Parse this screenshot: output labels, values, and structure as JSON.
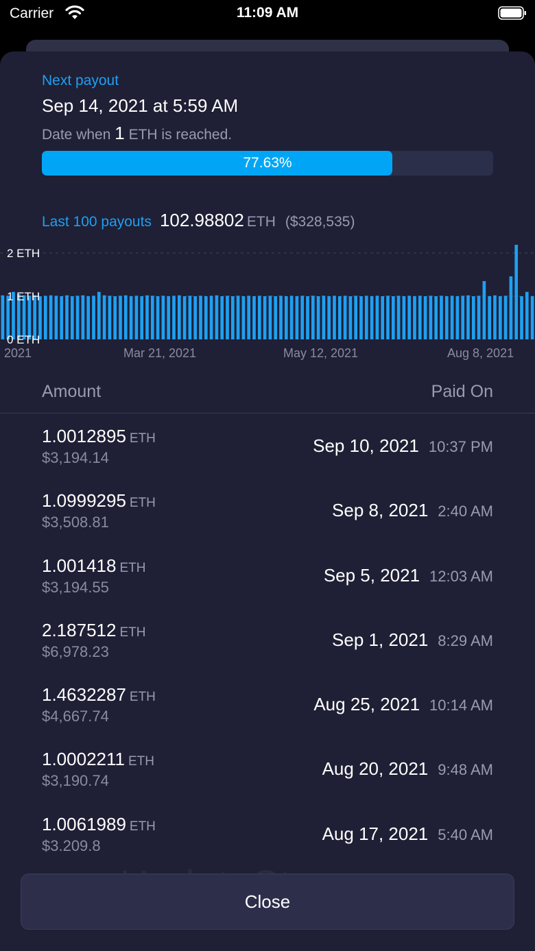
{
  "status_bar": {
    "carrier": "Carrier",
    "time": "11:09 AM"
  },
  "next_payout": {
    "label": "Next payout",
    "date": "Sep 14, 2021 at 5:59 AM",
    "hint_prefix": "Date when",
    "hint_amount": "1",
    "hint_suffix": "ETH is reached.",
    "progress_text": "77.63%",
    "progress_value": 0.7763
  },
  "summary": {
    "label": "Last 100 payouts",
    "total": "102.98802",
    "unit": "ETH",
    "usd": "($328,535)"
  },
  "chart_data": {
    "type": "bar",
    "y_ticks": [
      "2 ETH",
      "1 ETH",
      "0 ETH"
    ],
    "x_ticks": [
      ", 2021",
      "Mar 21, 2021",
      "May 12, 2021",
      "Aug 8, 2021"
    ],
    "ylim": [
      0,
      2
    ],
    "values": [
      1.02,
      1.01,
      1.1,
      1.05,
      1.02,
      1.01,
      1.02,
      1.0,
      1.01,
      1.02,
      1.01,
      1.0,
      1.02,
      1.0,
      1.01,
      1.02,
      1.0,
      1.01,
      1.1,
      1.02,
      1.01,
      1.0,
      1.01,
      1.02,
      1.0,
      1.01,
      1.0,
      1.02,
      1.01,
      1.0,
      1.01,
      1.0,
      1.01,
      1.02,
      1.0,
      1.01,
      1.0,
      1.01,
      1.0,
      1.01,
      1.02,
      1.0,
      1.01,
      1.0,
      1.01,
      1.0,
      1.01,
      1.0,
      1.01,
      1.0,
      1.01,
      1.0,
      1.01,
      1.0,
      1.01,
      1.0,
      1.01,
      1.0,
      1.01,
      1.0,
      1.01,
      1.0,
      1.01,
      1.0,
      1.01,
      1.0,
      1.01,
      1.0,
      1.01,
      1.0,
      1.01,
      1.0,
      1.01,
      1.0,
      1.01,
      1.0,
      1.01,
      1.0,
      1.01,
      1.0,
      1.01,
      1.0,
      1.01,
      1.0,
      1.01,
      1.0,
      1.01,
      1.02,
      1.0,
      1.01,
      1.35,
      1.0,
      1.02,
      1.0,
      1.01,
      1.46,
      2.19,
      1.0,
      1.1,
      1.0
    ],
    "bar_color": "#1ea0f2",
    "grid_color": "#3a3c55"
  },
  "table": {
    "col_amount": "Amount",
    "col_paid": "Paid On",
    "rows": [
      {
        "amount": "1.0012895",
        "unit": "ETH",
        "usd": "$3,194.14",
        "date": "Sep 10, 2021",
        "time": "10:37 PM"
      },
      {
        "amount": "1.0999295",
        "unit": "ETH",
        "usd": "$3,508.81",
        "date": "Sep 8, 2021",
        "time": "2:40 AM"
      },
      {
        "amount": "1.001418",
        "unit": "ETH",
        "usd": "$3,194.55",
        "date": "Sep 5, 2021",
        "time": "12:03 AM"
      },
      {
        "amount": "2.187512",
        "unit": "ETH",
        "usd": "$6,978.23",
        "date": "Sep 1, 2021",
        "time": "8:29 AM"
      },
      {
        "amount": "1.4632287",
        "unit": "ETH",
        "usd": "$4,667.74",
        "date": "Aug 25, 2021",
        "time": "10:14 AM"
      },
      {
        "amount": "1.0002211",
        "unit": "ETH",
        "usd": "$3,190.74",
        "date": "Aug 20, 2021",
        "time": "9:48 AM"
      },
      {
        "amount": "1.0061989",
        "unit": "ETH",
        "usd": "$3.209.8",
        "date": "Aug 17, 2021",
        "time": "5:40 AM"
      }
    ]
  },
  "watermark": "UpdateStar.com",
  "close_label": "Close"
}
